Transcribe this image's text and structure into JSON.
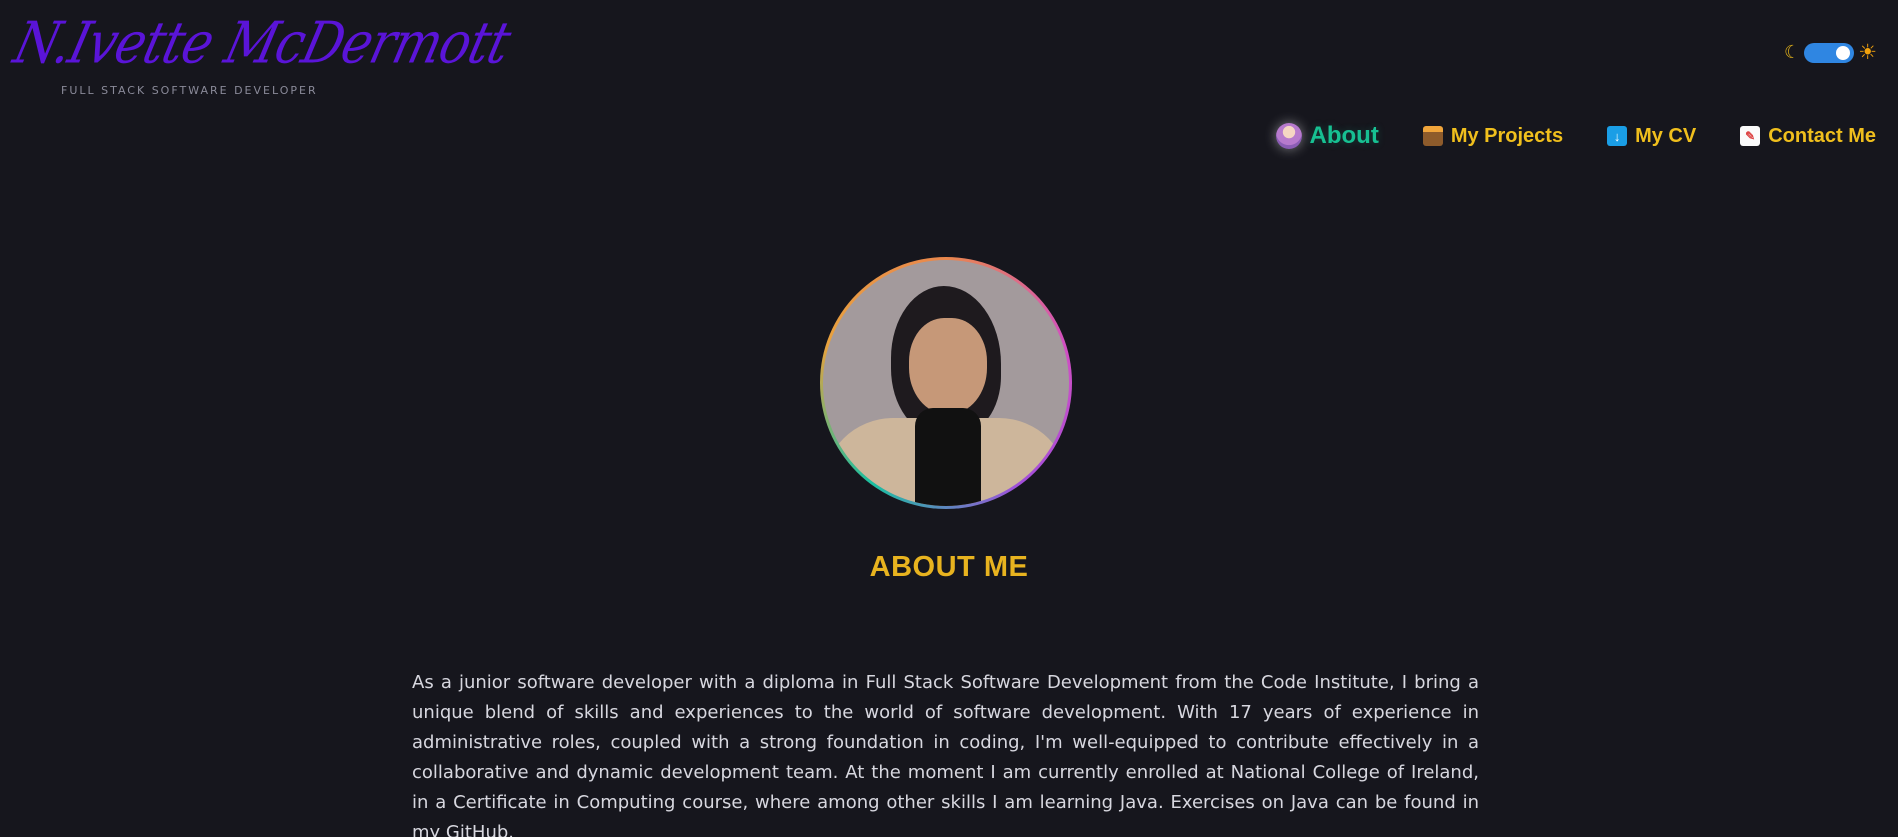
{
  "logo": {
    "name": "N.Ivette McDermott",
    "subtitle": "FULL STACK SOFTWARE DEVELOPER"
  },
  "theme_toggle": {
    "dark_icon": "moon-icon",
    "light_icon": "sun-icon",
    "state": "dark"
  },
  "nav": {
    "items": [
      {
        "label": "About",
        "icon": "raising-hand-person-icon",
        "active": true
      },
      {
        "label": "My Projects",
        "icon": "card-file-box-icon",
        "active": false
      },
      {
        "label": "My CV",
        "icon": "download-arrow-icon",
        "active": false
      },
      {
        "label": "Contact Me",
        "icon": "memo-icon",
        "active": false
      }
    ]
  },
  "about": {
    "title": "ABOUT ME",
    "text": "As a junior software developer with a diploma in Full Stack Software Development from the Code Institute, I bring a unique blend of skills and experiences to the world of software development. With 17 years of experience in administrative roles, coupled with a strong foundation in coding, I'm well-equipped to contribute effectively in a collaborative and dynamic development team. At the moment I am currently enrolled at National College of Ireland, in a Certificate in Computing course, where among other skills I am learning Java. Exercises on Java can be found in my GitHub."
  },
  "colors": {
    "background": "#16161d",
    "accent_yellow": "#e8b31f",
    "accent_green": "#17c092",
    "logo_purple": "#5a14d8"
  }
}
